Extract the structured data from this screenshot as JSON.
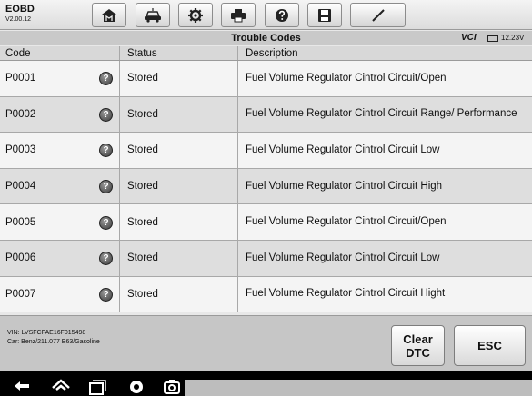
{
  "app": {
    "title": "EOBD",
    "version": "V2.00.12"
  },
  "toolbar": {
    "icons": [
      "home-icon",
      "vehicle-icon",
      "gear-icon",
      "printer-icon",
      "help-icon",
      "save-icon",
      "pen-icon"
    ]
  },
  "titlebar": {
    "title": "Trouble Codes",
    "vci": "VCI",
    "battery": "12.23V"
  },
  "table": {
    "headers": {
      "code": "Code",
      "status": "Status",
      "description": "Description"
    },
    "rows": [
      {
        "code": "P0001",
        "status": "Stored",
        "description": "Fuel Volume Regulator Cintrol Circuit/Open"
      },
      {
        "code": "P0002",
        "status": "Stored",
        "description": "Fuel Volume Regulator Cintrol Circuit Range/ Performance"
      },
      {
        "code": "P0003",
        "status": "Stored",
        "description": "Fuel Volume Regulator Cintrol Circuit Low"
      },
      {
        "code": "P0004",
        "status": "Stored",
        "description": "Fuel Volume Regulator Cintrol Circuit High"
      },
      {
        "code": "P0005",
        "status": "Stored",
        "description": "Fuel Volume Regulator Cintrol Circuit/Open"
      },
      {
        "code": "P0006",
        "status": "Stored",
        "description": "Fuel Volume Regulator Cintrol Circuit Low"
      },
      {
        "code": "P0007",
        "status": "Stored",
        "description": "Fuel Volume Regulator Cintrol Circuit Hight"
      }
    ]
  },
  "footer": {
    "vin": "VIN: LVSFCFAE16F015498",
    "car": "Car: Benz/211.077 E63/Gasoline",
    "clear_label": "Clear DTC",
    "esc_label": "ESC"
  },
  "colors": {
    "toolbar": "#e6e6e6",
    "titlebar": "#c9c9c9",
    "row_light": "#f4f4f4",
    "row_dark": "#dedede",
    "navbar": "#000000"
  }
}
